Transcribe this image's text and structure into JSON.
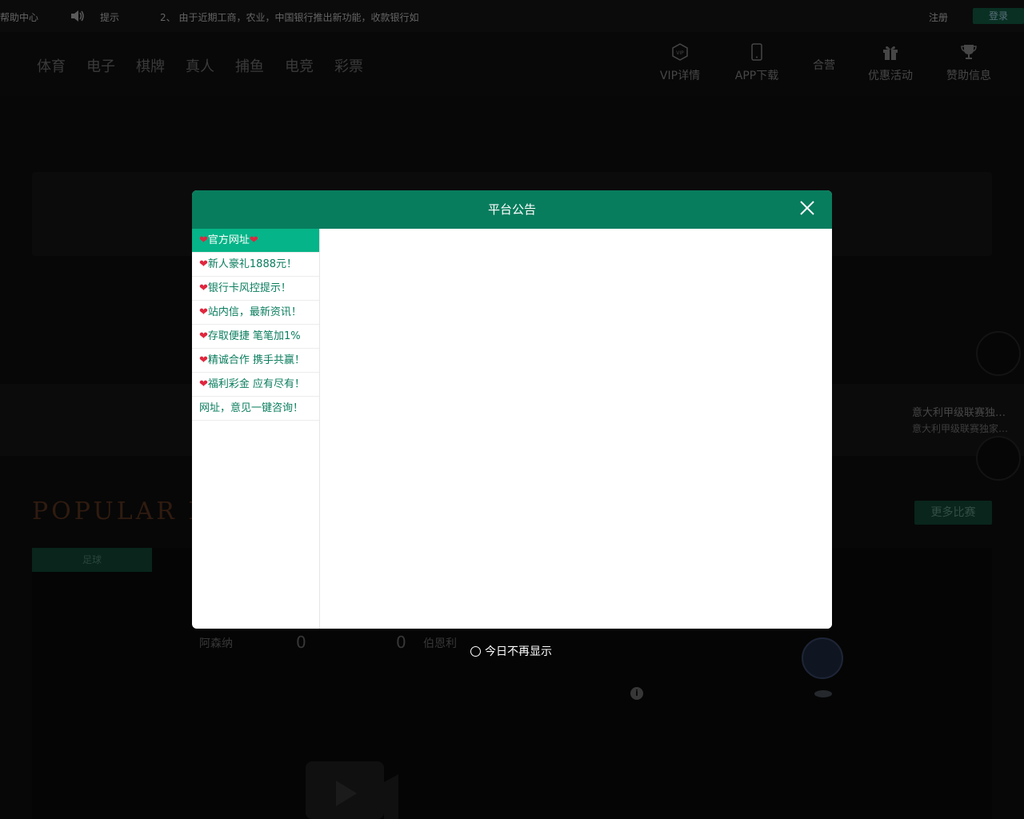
{
  "topbar": {
    "help": "帮助中心",
    "tip": "提示",
    "marquee": "2、 由于近期工商，农业，中国银行推出新功能，收款银行如",
    "register": "注册",
    "login": "登录"
  },
  "nav": [
    "体育",
    "电子",
    "棋牌",
    "真人",
    "捕鱼",
    "电竞",
    "彩票"
  ],
  "header_links": [
    {
      "label": "VIP详情",
      "icon": "vip-icon"
    },
    {
      "label": "APP下载",
      "icon": "phone-icon"
    },
    {
      "label": "合营",
      "icon": ""
    },
    {
      "label": "优惠活动",
      "icon": "gift-icon"
    },
    {
      "label": "赞助信息",
      "icon": "trophy-icon"
    }
  ],
  "news": {
    "line1": "意大利甲级联赛独…",
    "line2": "意大利甲级联赛独家…"
  },
  "popular": "POPULAR LI",
  "more_matches": "更多比赛",
  "tab_football": "足球",
  "match": {
    "team_a": "阿森纳",
    "score_a": "0",
    "score_b": "0",
    "team_b": "伯恩利"
  },
  "modal": {
    "title": "平台公告",
    "items": [
      {
        "pre": "❤",
        "text": "官方网址",
        "post": "❤"
      },
      {
        "pre": "❤",
        "text": "新人豪礼1888元！",
        "post": ""
      },
      {
        "pre": "❤",
        "text": "银行卡风控提示！",
        "post": ""
      },
      {
        "pre": "❤",
        "text": "站内信，最新资讯！",
        "post": ""
      },
      {
        "pre": "❤",
        "text": "存取便捷 笔笔加1%",
        "post": ""
      },
      {
        "pre": "❤",
        "text": "精诚合作 携手共赢！",
        "post": ""
      },
      {
        "pre": "❤",
        "text": "福利彩金 应有尽有！",
        "post": ""
      },
      {
        "pre": "",
        "text": "网址，意见一键咨询！",
        "post": ""
      }
    ],
    "dismiss": "今日不再显示"
  },
  "colors": {
    "modal_header": "#087d5e",
    "active_item": "#05b488",
    "heart": "#e0263e"
  }
}
